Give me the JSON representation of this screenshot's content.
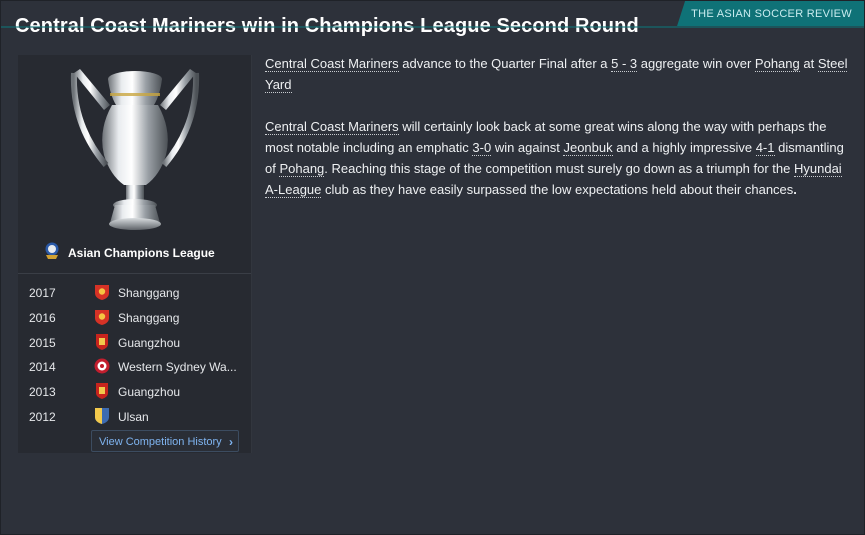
{
  "header": {
    "title": "Central Coast Mariners win in Champions League Second Round",
    "source": "THE ASIAN SOCCER REVIEW"
  },
  "competition": {
    "name": "Asian Champions League",
    "icon": "acl-logo-icon"
  },
  "history": {
    "rows": [
      {
        "year": "2017",
        "team": "Shanggang",
        "badge": "shanggang-badge-icon",
        "color": "#d63226"
      },
      {
        "year": "2016",
        "team": "Shanggang",
        "badge": "shanggang-badge-icon",
        "color": "#d63226"
      },
      {
        "year": "2015",
        "team": "Guangzhou",
        "badge": "guangzhou-badge-icon",
        "color": "#c8241d"
      },
      {
        "year": "2014",
        "team": "Western Sydney Wa...",
        "badge": "wsw-badge-icon",
        "color": "#c21e2e"
      },
      {
        "year": "2013",
        "team": "Guangzhou",
        "badge": "guangzhou-badge-icon",
        "color": "#c8241d"
      },
      {
        "year": "2012",
        "team": "Ulsan",
        "badge": "ulsan-badge-icon",
        "color": "#3d6bb0"
      }
    ],
    "button_label": "View Competition History"
  },
  "article": {
    "p1": {
      "team": "Central Coast Mariners",
      "t1": " advance to the Quarter Final after a ",
      "score": "5 - 3",
      "t2": " aggregate win over ",
      "opponent": "Pohang",
      "t3": " at ",
      "venue": "Steel Yard"
    },
    "p2": {
      "team": "Central Coast Mariners",
      "t1": " will certainly look back at some great wins along the way with perhaps the most notable including an emphatic ",
      "score1": "3-0",
      "t2": " win against ",
      "opp1": "Jeonbuk",
      "t3": " and a highly impressive ",
      "score2": "4-1",
      "t4": " dismantling of ",
      "opp2": "Pohang",
      "t5": ". Reaching this stage of the competition must surely go down as a triumph for the ",
      "league": "Hyundai A-League",
      "t6": " club as they have easily surpassed the low expectations held about their chances",
      "end": "."
    }
  },
  "colors": {
    "accent": "#0f7277",
    "link": "#7fb4f0",
    "background": "#2d313a",
    "panel": "#272a31"
  }
}
